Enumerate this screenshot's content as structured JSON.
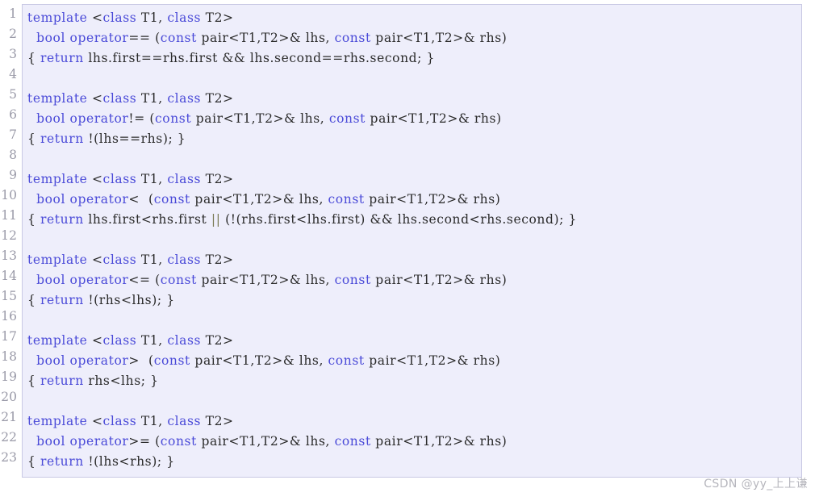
{
  "code_block": {
    "language": "cpp",
    "background_color": "#eeeefb",
    "border_color": "#c9c9e4",
    "keyword_color": "#4a4ad8",
    "operator_color": "#7a7a55",
    "text_color": "#2b2b2b",
    "line_number_color": "#9a9aa8",
    "line_numbers": [
      "1",
      "2",
      "3",
      "4",
      "5",
      "6",
      "7",
      "8",
      "9",
      "10",
      "11",
      "12",
      "13",
      "14",
      "15",
      "16",
      "17",
      "18",
      "19",
      "20",
      "21",
      "22",
      "23"
    ],
    "lines": [
      {
        "n": "1",
        "tokens": [
          {
            "t": "template",
            "c": "kw"
          },
          {
            "t": " <",
            "c": "id"
          },
          {
            "t": "class",
            "c": "kw"
          },
          {
            "t": " T1, ",
            "c": "id"
          },
          {
            "t": "class",
            "c": "kw"
          },
          {
            "t": " T2>",
            "c": "id"
          }
        ]
      },
      {
        "n": "2",
        "tokens": [
          {
            "t": "  ",
            "c": "id"
          },
          {
            "t": "bool",
            "c": "kw"
          },
          {
            "t": " ",
            "c": "id"
          },
          {
            "t": "operator",
            "c": "kw"
          },
          {
            "t": "== (",
            "c": "id"
          },
          {
            "t": "const",
            "c": "kw"
          },
          {
            "t": " pair<T1,T2>& lhs, ",
            "c": "id"
          },
          {
            "t": "const",
            "c": "kw"
          },
          {
            "t": " pair<T1,T2>& rhs)",
            "c": "id"
          }
        ]
      },
      {
        "n": "3",
        "tokens": [
          {
            "t": "{ ",
            "c": "id"
          },
          {
            "t": "return",
            "c": "kw"
          },
          {
            "t": " lhs.first==rhs.first && lhs.second==rhs.second; }",
            "c": "id"
          }
        ]
      },
      {
        "n": "4",
        "tokens": []
      },
      {
        "n": "5",
        "tokens": [
          {
            "t": "template",
            "c": "kw"
          },
          {
            "t": " <",
            "c": "id"
          },
          {
            "t": "class",
            "c": "kw"
          },
          {
            "t": " T1, ",
            "c": "id"
          },
          {
            "t": "class",
            "c": "kw"
          },
          {
            "t": " T2>",
            "c": "id"
          }
        ]
      },
      {
        "n": "6",
        "tokens": [
          {
            "t": "  ",
            "c": "id"
          },
          {
            "t": "bool",
            "c": "kw"
          },
          {
            "t": " ",
            "c": "id"
          },
          {
            "t": "operator",
            "c": "kw"
          },
          {
            "t": "!= (",
            "c": "id"
          },
          {
            "t": "const",
            "c": "kw"
          },
          {
            "t": " pair<T1,T2>& lhs, ",
            "c": "id"
          },
          {
            "t": "const",
            "c": "kw"
          },
          {
            "t": " pair<T1,T2>& rhs)",
            "c": "id"
          }
        ]
      },
      {
        "n": "7",
        "tokens": [
          {
            "t": "{ ",
            "c": "id"
          },
          {
            "t": "return",
            "c": "kw"
          },
          {
            "t": " !(lhs==rhs); }",
            "c": "id"
          }
        ]
      },
      {
        "n": "8",
        "tokens": []
      },
      {
        "n": "9",
        "tokens": [
          {
            "t": "template",
            "c": "kw"
          },
          {
            "t": " <",
            "c": "id"
          },
          {
            "t": "class",
            "c": "kw"
          },
          {
            "t": " T1, ",
            "c": "id"
          },
          {
            "t": "class",
            "c": "kw"
          },
          {
            "t": " T2>",
            "c": "id"
          }
        ]
      },
      {
        "n": "10",
        "tokens": [
          {
            "t": "  ",
            "c": "id"
          },
          {
            "t": "bool",
            "c": "kw"
          },
          {
            "t": " ",
            "c": "id"
          },
          {
            "t": "operator",
            "c": "kw"
          },
          {
            "t": "<  (",
            "c": "id"
          },
          {
            "t": "const",
            "c": "kw"
          },
          {
            "t": " pair<T1,T2>& lhs, ",
            "c": "id"
          },
          {
            "t": "const",
            "c": "kw"
          },
          {
            "t": " pair<T1,T2>& rhs)",
            "c": "id"
          }
        ]
      },
      {
        "n": "11",
        "tokens": [
          {
            "t": "{ ",
            "c": "id"
          },
          {
            "t": "return",
            "c": "kw"
          },
          {
            "t": " lhs.first<rhs.first ",
            "c": "id"
          },
          {
            "t": "||",
            "c": "op"
          },
          {
            "t": " (!(rhs.first<lhs.first) && lhs.second<rhs.second); }",
            "c": "id"
          }
        ]
      },
      {
        "n": "12",
        "tokens": []
      },
      {
        "n": "13",
        "tokens": [
          {
            "t": "template",
            "c": "kw"
          },
          {
            "t": " <",
            "c": "id"
          },
          {
            "t": "class",
            "c": "kw"
          },
          {
            "t": " T1, ",
            "c": "id"
          },
          {
            "t": "class",
            "c": "kw"
          },
          {
            "t": " T2>",
            "c": "id"
          }
        ]
      },
      {
        "n": "14",
        "tokens": [
          {
            "t": "  ",
            "c": "id"
          },
          {
            "t": "bool",
            "c": "kw"
          },
          {
            "t": " ",
            "c": "id"
          },
          {
            "t": "operator",
            "c": "kw"
          },
          {
            "t": "<= (",
            "c": "id"
          },
          {
            "t": "const",
            "c": "kw"
          },
          {
            "t": " pair<T1,T2>& lhs, ",
            "c": "id"
          },
          {
            "t": "const",
            "c": "kw"
          },
          {
            "t": " pair<T1,T2>& rhs)",
            "c": "id"
          }
        ]
      },
      {
        "n": "15",
        "tokens": [
          {
            "t": "{ ",
            "c": "id"
          },
          {
            "t": "return",
            "c": "kw"
          },
          {
            "t": " !(rhs<lhs); }",
            "c": "id"
          }
        ]
      },
      {
        "n": "16",
        "tokens": []
      },
      {
        "n": "17",
        "tokens": [
          {
            "t": "template",
            "c": "kw"
          },
          {
            "t": " <",
            "c": "id"
          },
          {
            "t": "class",
            "c": "kw"
          },
          {
            "t": " T1, ",
            "c": "id"
          },
          {
            "t": "class",
            "c": "kw"
          },
          {
            "t": " T2>",
            "c": "id"
          }
        ]
      },
      {
        "n": "18",
        "tokens": [
          {
            "t": "  ",
            "c": "id"
          },
          {
            "t": "bool",
            "c": "kw"
          },
          {
            "t": " ",
            "c": "id"
          },
          {
            "t": "operator",
            "c": "kw"
          },
          {
            "t": ">  (",
            "c": "id"
          },
          {
            "t": "const",
            "c": "kw"
          },
          {
            "t": " pair<T1,T2>& lhs, ",
            "c": "id"
          },
          {
            "t": "const",
            "c": "kw"
          },
          {
            "t": " pair<T1,T2>& rhs)",
            "c": "id"
          }
        ]
      },
      {
        "n": "19",
        "tokens": [
          {
            "t": "{ ",
            "c": "id"
          },
          {
            "t": "return",
            "c": "kw"
          },
          {
            "t": " rhs<lhs; }",
            "c": "id"
          }
        ]
      },
      {
        "n": "20",
        "tokens": []
      },
      {
        "n": "21",
        "tokens": [
          {
            "t": "template",
            "c": "kw"
          },
          {
            "t": " <",
            "c": "id"
          },
          {
            "t": "class",
            "c": "kw"
          },
          {
            "t": " T1, ",
            "c": "id"
          },
          {
            "t": "class",
            "c": "kw"
          },
          {
            "t": " T2>",
            "c": "id"
          }
        ]
      },
      {
        "n": "22",
        "tokens": [
          {
            "t": "  ",
            "c": "id"
          },
          {
            "t": "bool",
            "c": "kw"
          },
          {
            "t": " ",
            "c": "id"
          },
          {
            "t": "operator",
            "c": "kw"
          },
          {
            "t": ">= (",
            "c": "id"
          },
          {
            "t": "const",
            "c": "kw"
          },
          {
            "t": " pair<T1,T2>& lhs, ",
            "c": "id"
          },
          {
            "t": "const",
            "c": "kw"
          },
          {
            "t": " pair<T1,T2>& rhs)",
            "c": "id"
          }
        ]
      },
      {
        "n": "23",
        "tokens": [
          {
            "t": "{ ",
            "c": "id"
          },
          {
            "t": "return",
            "c": "kw"
          },
          {
            "t": " !(lhs<rhs); }",
            "c": "id"
          }
        ]
      }
    ]
  },
  "watermark": {
    "text": "CSDN @yy_上上谦"
  }
}
